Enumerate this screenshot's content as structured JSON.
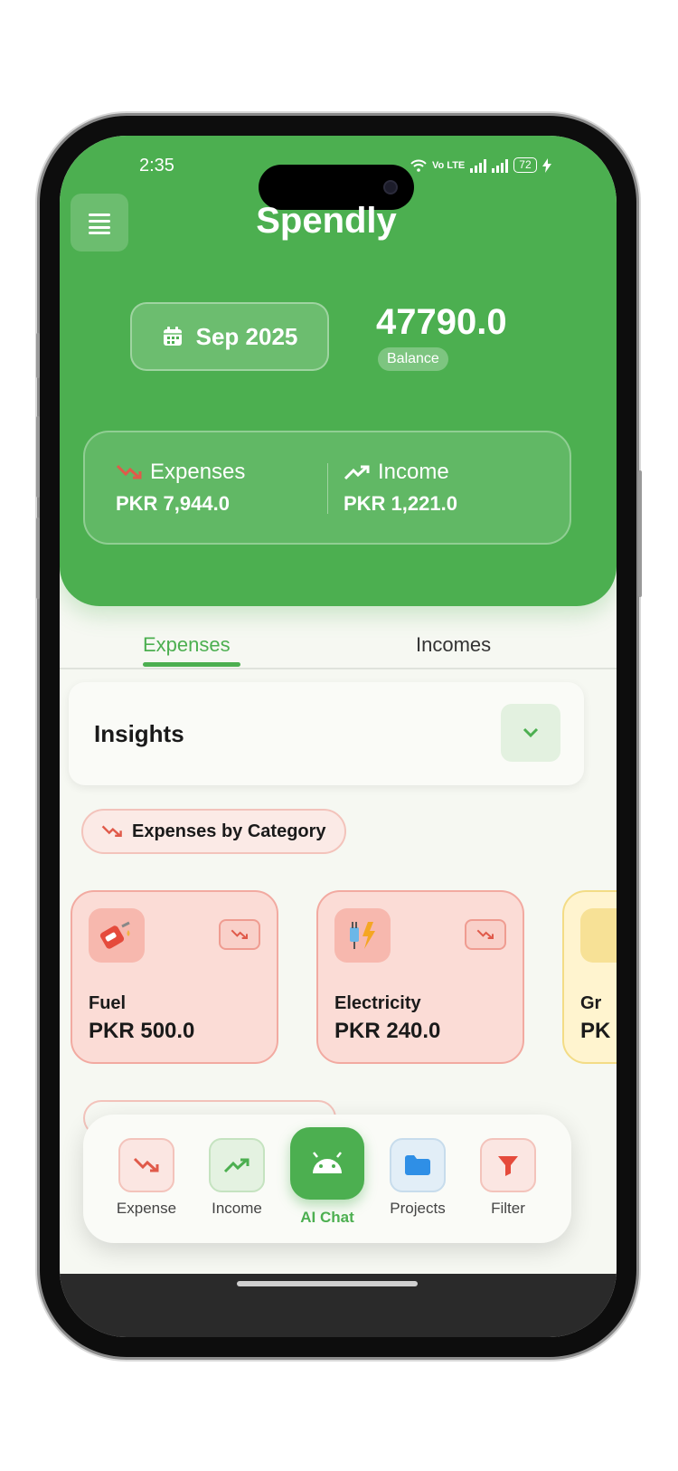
{
  "status_bar": {
    "time": "2:35",
    "network": "Vo LTE",
    "battery": "72"
  },
  "header": {
    "title": "Spendly",
    "month": "Sep 2025",
    "balance_value": "47790.0",
    "balance_label": "Balance"
  },
  "summary": {
    "expenses_label": "Expenses",
    "expenses_value": "PKR 7,944.0",
    "income_label": "Income",
    "income_value": "PKR 1,221.0"
  },
  "tabs": {
    "active": "Expenses",
    "inactive": "Incomes"
  },
  "insights": {
    "title": "Insights"
  },
  "category_section": {
    "label": "Expenses by Category"
  },
  "categories": [
    {
      "name": "Fuel",
      "amount": "PKR 500.0"
    },
    {
      "name": "Electricity",
      "amount": "PKR 240.0"
    },
    {
      "name": "Gr",
      "amount": "PK"
    }
  ],
  "bottom_nav": [
    {
      "label": "Expense",
      "icon": "trend-down-icon"
    },
    {
      "label": "Income",
      "icon": "trend-up-icon"
    },
    {
      "label": "AI Chat",
      "icon": "android-icon"
    },
    {
      "label": "Projects",
      "icon": "folder-icon"
    },
    {
      "label": "Filter",
      "icon": "filter-icon"
    }
  ],
  "colors": {
    "primary": "#4caf50",
    "expense": "#e05a4a",
    "income": "#4caf50",
    "projects": "#2f8fe6"
  }
}
